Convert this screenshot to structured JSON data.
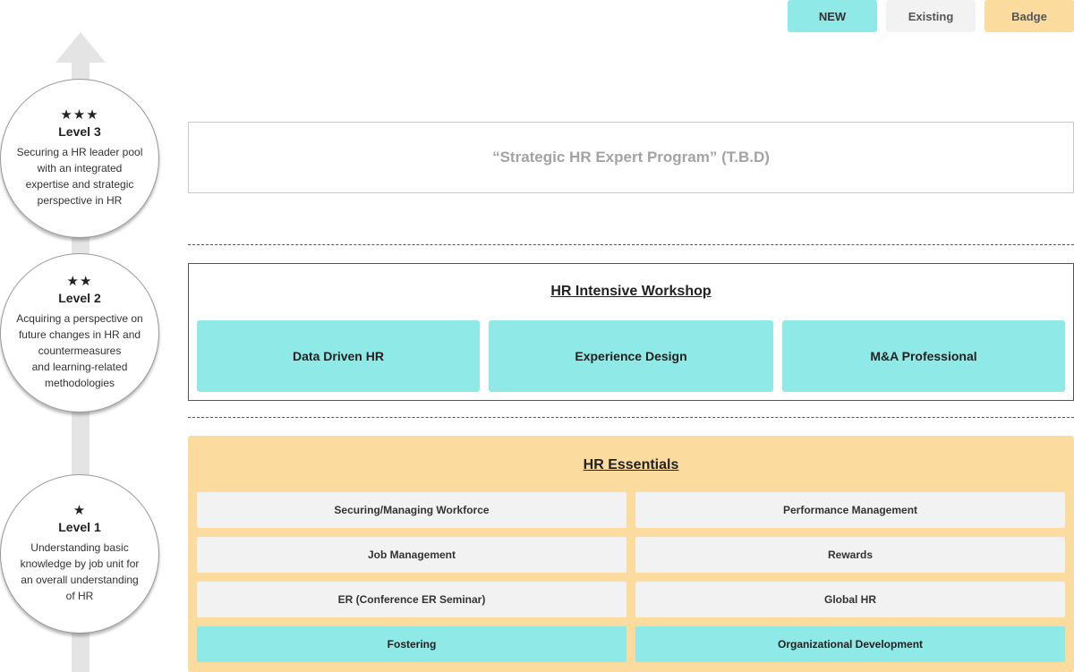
{
  "legend": [
    {
      "label": "NEW",
      "color": "#8fe9e6"
    },
    {
      "label": "Existing",
      "color": "#f2f2f2"
    },
    {
      "label": "Badge",
      "color": "#fcdc9e"
    }
  ],
  "levels": {
    "level3": {
      "stars": "★★★",
      "label": "Level 3",
      "description": "Securing a HR leader pool\nwith an integrated\nexpertise and strategic\nperspective in HR"
    },
    "level2": {
      "stars": "★★",
      "label": "Level 2",
      "description": "Acquiring a perspective on\nfuture changes in HR and\ncountermeasures\nand learning-related\nmethodologies"
    },
    "level1": {
      "stars": "★",
      "label": "Level 1",
      "description": "Understanding basic\nknowledge by job unit for\nan overall understanding\nof HR"
    }
  },
  "level3_program": "“Strategic HR Expert Program” (T.B.D)",
  "workshop": {
    "title": "HR Intensive Workshop",
    "items": [
      "Data Driven HR",
      "Experience Design",
      "M&A Professional"
    ]
  },
  "essentials": {
    "title": "HR Essentials",
    "items": [
      {
        "label": "Securing/Managing Workforce",
        "type": "existing"
      },
      {
        "label": "Performance Management",
        "type": "existing"
      },
      {
        "label": "Job Management",
        "type": "existing"
      },
      {
        "label": "Rewards",
        "type": "existing"
      },
      {
        "label": "ER (Conference ER Seminar)",
        "type": "existing"
      },
      {
        "label": "Global HR",
        "type": "existing"
      },
      {
        "label": "Fostering",
        "type": "new"
      },
      {
        "label": "Organizational Development",
        "type": "new"
      }
    ]
  }
}
